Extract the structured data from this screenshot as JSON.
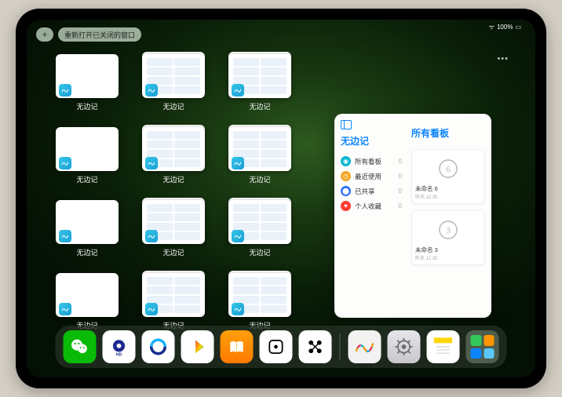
{
  "status": {
    "wifi": "􀙇",
    "battery": "100%"
  },
  "topbar": {
    "add_label": "+",
    "reopen_label": "重新打开已关闭的窗口"
  },
  "thumbs": [
    {
      "label": "无边记",
      "view": false
    },
    {
      "label": "无边记",
      "view": true
    },
    {
      "label": "无边记",
      "view": true
    },
    {
      "label": "无边记",
      "view": false
    },
    {
      "label": "无边记",
      "view": true
    },
    {
      "label": "无边记",
      "view": true
    },
    {
      "label": "无边记",
      "view": false
    },
    {
      "label": "无边记",
      "view": true
    },
    {
      "label": "无边记",
      "view": true
    },
    {
      "label": "无边记",
      "view": false
    },
    {
      "label": "无边记",
      "view": true
    },
    {
      "label": "无边记",
      "view": true
    }
  ],
  "panel": {
    "left_title": "无边记",
    "right_title": "所有看板",
    "nav": [
      {
        "label": "所有看板",
        "count": "0",
        "color": "#09b6d1"
      },
      {
        "label": "最近使用",
        "count": "0",
        "color": "#f5a623"
      },
      {
        "label": "已共享",
        "count": "0",
        "color": "#2e6dff"
      },
      {
        "label": "个人收藏",
        "count": "0",
        "color": "#ff3b30"
      }
    ],
    "cards": [
      {
        "title": "未命名 6",
        "sub": "昨天 11:25",
        "glyph": "6"
      },
      {
        "title": "未命名 3",
        "sub": "昨天 11:25",
        "glyph": "3"
      }
    ]
  },
  "dock": [
    {
      "name": "wechat"
    },
    {
      "name": "quark-hd"
    },
    {
      "name": "quark"
    },
    {
      "name": "media"
    },
    {
      "name": "books"
    },
    {
      "name": "dice"
    },
    {
      "name": "connect"
    },
    {
      "name": "freeform"
    },
    {
      "name": "settings"
    },
    {
      "name": "notes"
    },
    {
      "name": "folder"
    }
  ]
}
